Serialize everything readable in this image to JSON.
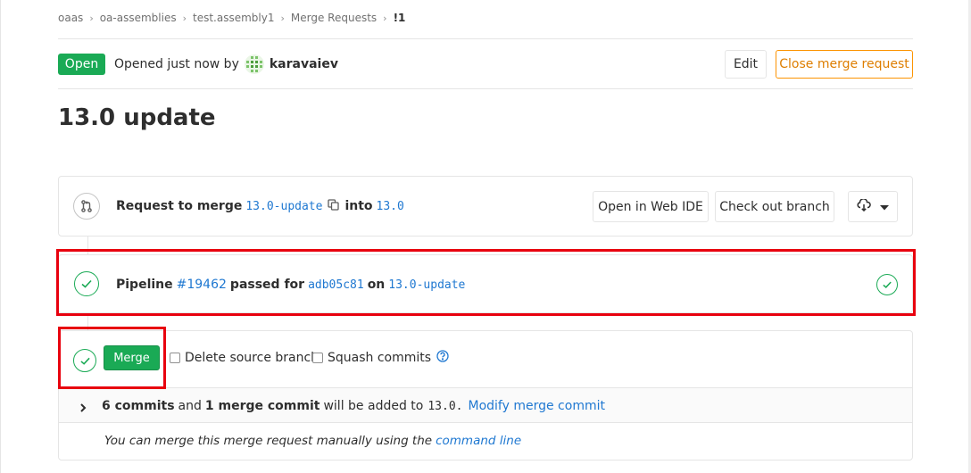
{
  "breadcrumb": [
    "oaas",
    "oa-assemblies",
    "test.assembly1",
    "Merge Requests",
    "!1"
  ],
  "header": {
    "status": "Open",
    "opened_text": "Opened just now by",
    "author": "karavaiev",
    "edit_label": "Edit",
    "close_label": "Close merge request"
  },
  "title": "13.0 update",
  "branch": {
    "prefix": "Request to merge",
    "source": "13.0-update",
    "into_label": "into",
    "target": "13.0",
    "open_ide_label": "Open in Web IDE",
    "checkout_label": "Check out branch"
  },
  "pipeline": {
    "label": "Pipeline",
    "number": "#19462",
    "passed_for": "passed for",
    "commit": "adb05c81",
    "on_label": "on",
    "branch": "13.0-update"
  },
  "merge": {
    "button_label": "Merge",
    "delete_branch_label": "Delete source branch",
    "squash_label": "Squash commits",
    "commits_count": "6 commits",
    "and_label": "and",
    "merge_commit": "1 merge commit",
    "will_be_added": "will be added to",
    "target": "13.0.",
    "modify_link": "Modify merge commit",
    "manual_text": "You can merge this merge request manually using the",
    "command_line_link": "command line"
  },
  "colors": {
    "success": "#1aaa55",
    "link": "#1f78d1",
    "warning_border": "#fc9403",
    "annotation": "#e8000e"
  }
}
